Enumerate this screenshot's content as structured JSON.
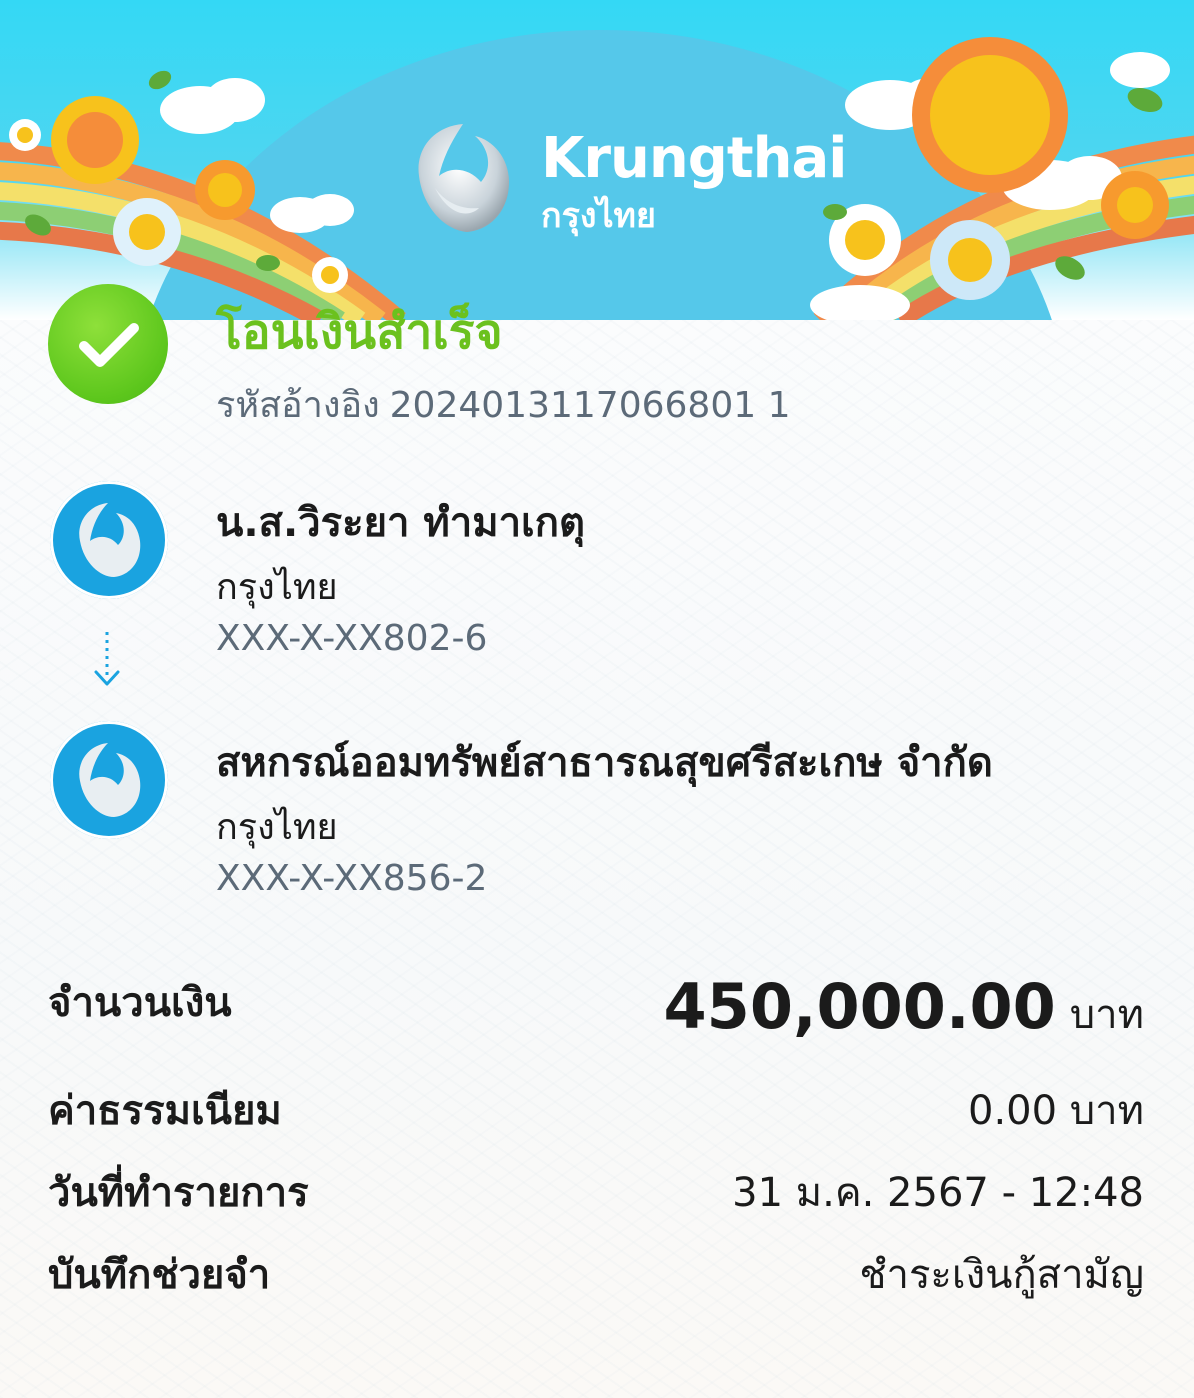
{
  "header": {
    "brand_en": "Krungthai",
    "brand_th": "กรุงไทย"
  },
  "status": {
    "icon": "check-icon",
    "title": "โอนเงินสำเร็จ",
    "ref_label": "รหัสอ้างอิง",
    "ref_number": "2024013117066801 1"
  },
  "sender": {
    "name": "น.ส.วิระยา ทำมาเกตุ",
    "bank": "กรุงไทย",
    "account": "XXX-X-XX802-6"
  },
  "receiver": {
    "name": "สหกรณ์ออมทรัพย์สาธารณสุขศรีสะเกษ จำกัด",
    "bank": "กรุงไทย",
    "account": "XXX-X-XX856-2"
  },
  "details": {
    "amount_label": "จำนวนเงิน",
    "amount_value": "450,000.00",
    "amount_unit": "บาท",
    "fee_label": "ค่าธรรมเนียม",
    "fee_value": "0.00 บาท",
    "date_label": "วันที่ทำรายการ",
    "date_value": "31 ม.ค. 2567 - 12:48",
    "memo_label": "บันทึกช่วยจำ",
    "memo_value": "ชำระเงินกู้สามัญ"
  },
  "colors": {
    "success": "#6bc11e",
    "bank_blue": "#1aa3e0",
    "muted": "#5c6a78",
    "header_sky": "#34d8f5"
  }
}
